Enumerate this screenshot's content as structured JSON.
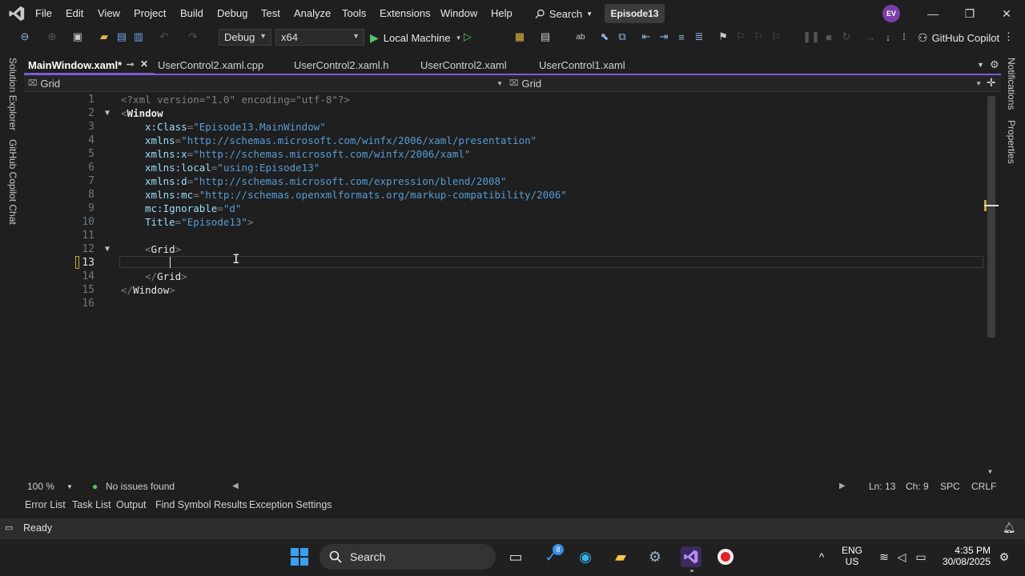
{
  "menu": [
    "File",
    "Edit",
    "View",
    "Project",
    "Build",
    "Debug",
    "Test",
    "Analyze",
    "Tools",
    "Extensions",
    "Window",
    "Help"
  ],
  "search": {
    "label": "Search"
  },
  "solution_name": "Episode13",
  "user_initials": "EV",
  "toolbar": {
    "config": "Debug",
    "platform": "x64",
    "run_target": "Local Machine",
    "copilot": "GitHub Copilot"
  },
  "left_rail": {
    "solution_explorer": "Solution Explorer",
    "copilot_chat": "GitHub Copilot Chat"
  },
  "right_rail": {
    "notifications": "Notifications",
    "properties": "Properties"
  },
  "tabs": [
    {
      "label": "MainWindow.xaml*"
    },
    {
      "label": "UserControl2.xaml.cpp"
    },
    {
      "label": "UserControl2.xaml.h"
    },
    {
      "label": "UserControl2.xaml"
    },
    {
      "label": "UserControl1.xaml"
    }
  ],
  "navbar": {
    "left": "Grid",
    "right": "Grid"
  },
  "editor": {
    "line_numbers": [
      "1",
      "2",
      "3",
      "4",
      "5",
      "6",
      "7",
      "8",
      "9",
      "10",
      "11",
      "12",
      "13",
      "14",
      "15",
      "16"
    ],
    "lines": {
      "l1": "<?xml version=\"1.0\" encoding=\"utf-8\"?>",
      "l2_tag": "Window",
      "l3_attr": "x:Class",
      "l3_val": "\"Episode13.MainWindow\"",
      "l4_attr": "xmlns",
      "l4_val": "\"http://schemas.microsoft.com/winfx/2006/xaml/presentation\"",
      "l5_attr": "xmlns:x",
      "l5_val": "\"http://schemas.microsoft.com/winfx/2006/xaml\"",
      "l6_attr": "xmlns:local",
      "l6_val": "\"using:Episode13\"",
      "l7_attr": "xmlns:d",
      "l7_val": "\"http://schemas.microsoft.com/expression/blend/2008\"",
      "l8_attr": "xmlns:mc",
      "l8_val": "\"http://schemas.openxmlformats.org/markup-compatibility/2006\"",
      "l9_attr": "mc:Ignorable",
      "l9_val": "\"d\"",
      "l10_attr": "Title",
      "l10_val": "\"Episode13\"",
      "l12_tag": "Grid",
      "l14_tag": "Grid",
      "l15_tag": "Window"
    }
  },
  "editor_status": {
    "zoom": "100 %",
    "issues": "No issues found",
    "line": "Ln: 13",
    "col": "Ch: 9",
    "whitespace": "SPC",
    "eol": "CRLF"
  },
  "tool_tabs": [
    "Error List",
    "Task List",
    "Output",
    "Find Symbol Results",
    "Exception Settings"
  ],
  "status": "Ready",
  "taskbar": {
    "search": "Search",
    "badge": "8",
    "lang1": "ENG",
    "lang2": "US",
    "time": "4:35 PM",
    "date": "30/08/2025"
  },
  "colors": {
    "accent": "#7e5bd6",
    "string": "#569cd6",
    "attribute": "#9cdcfe"
  }
}
